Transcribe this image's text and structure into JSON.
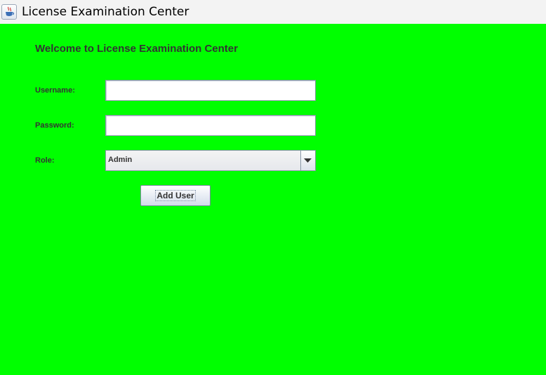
{
  "window": {
    "title": "License Examination Center",
    "icon": "java-cup-icon"
  },
  "form": {
    "heading": "Welcome to License Examination Center",
    "username_label": "Username:",
    "username_value": "",
    "password_label": "Password:",
    "password_value": "",
    "role_label": "Role:",
    "role_selected": "Admin",
    "add_user_label": "Add User"
  },
  "colors": {
    "background": "#00ff00",
    "text": "#333333"
  }
}
